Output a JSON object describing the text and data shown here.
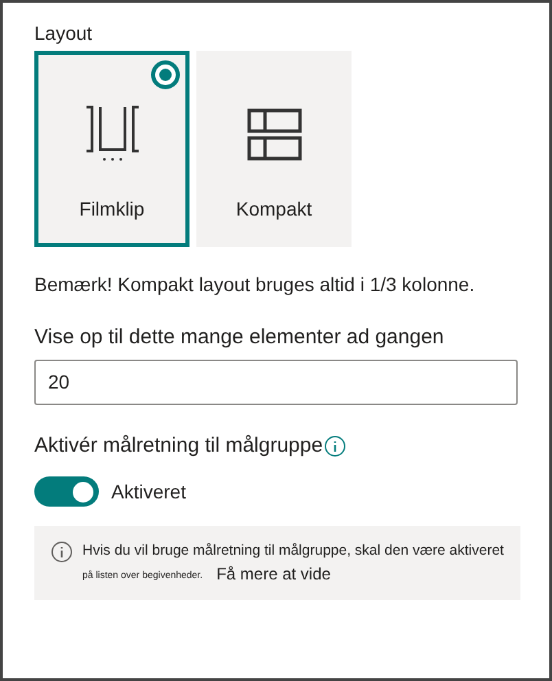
{
  "layout": {
    "label": "Layout",
    "options": [
      {
        "label": "Filmklip",
        "kind": "filmstrip",
        "selected": true
      },
      {
        "label": "Kompakt",
        "kind": "compact",
        "selected": false
      }
    ]
  },
  "note": "Bemærk! Kompakt layout bruges altid i 1/3 kolonne.",
  "items_field": {
    "label": "Vise op til dette mange elementer ad gangen",
    "value": "20"
  },
  "targeting": {
    "label": "Aktivér målretning til målgruppe",
    "toggle": {
      "on": true,
      "label": "Aktiveret"
    }
  },
  "info": {
    "text": "Hvis du vil bruge målretning til målgruppe, skal den være aktiveret",
    "small_text": "på listen over begivenheder.",
    "link": "Få mere at vide"
  }
}
